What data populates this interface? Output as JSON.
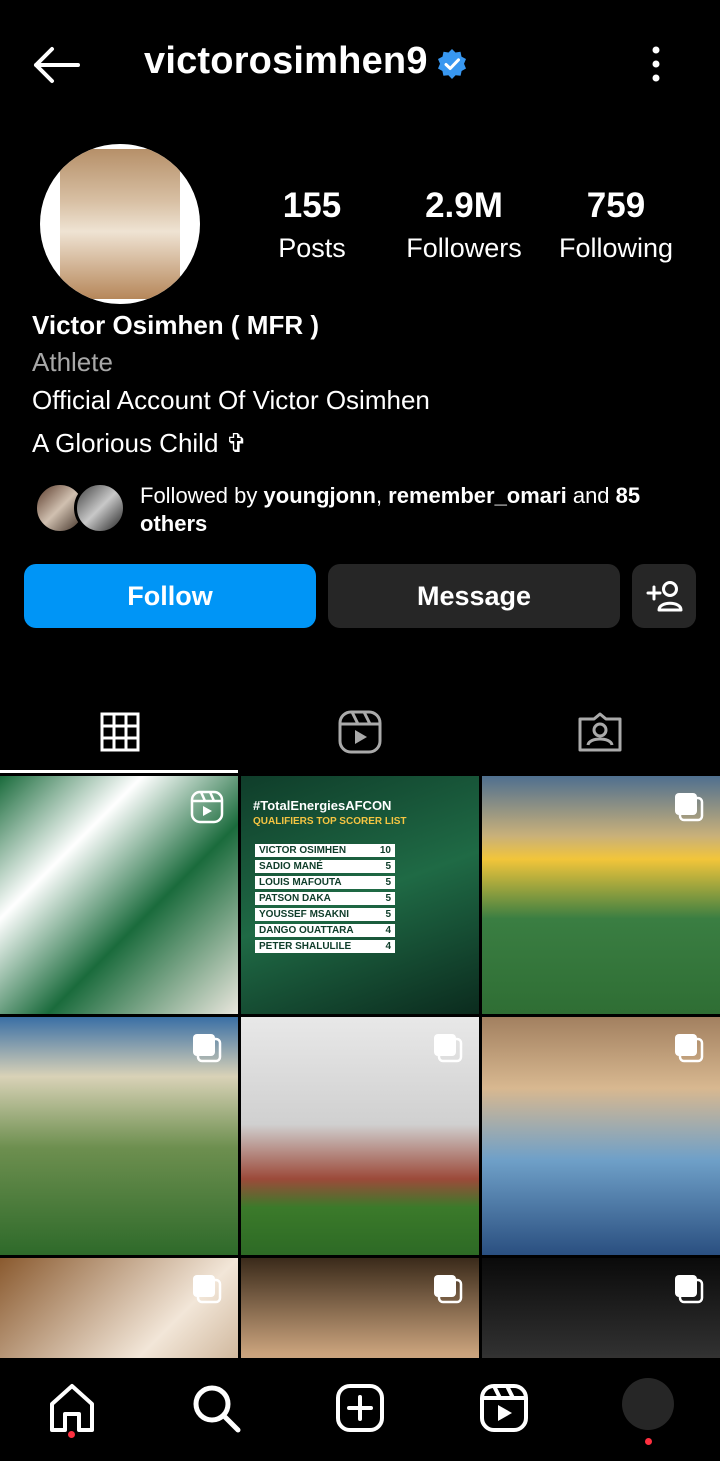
{
  "header": {
    "username": "victorosimhen9",
    "verified": true,
    "icons": [
      "back-arrow-icon",
      "verified-badge-icon",
      "more-options-icon"
    ]
  },
  "stats": {
    "posts": {
      "value": "155",
      "label": "Posts"
    },
    "followers": {
      "value": "2.9M",
      "label": "Followers"
    },
    "following": {
      "value": "759",
      "label": "Following"
    }
  },
  "profile": {
    "name": "Victor Osimhen ( MFR )",
    "category": "Athlete",
    "bio_line1": "Official Account Of Victor Osimhen",
    "bio_line2": "A Glorious Child ✞"
  },
  "followed_by": {
    "prefix": "Followed by ",
    "user1": "youngjonn",
    "separator": ", ",
    "user2": "remember_omari",
    "middle": " and ",
    "count": "85",
    "suffix": "others"
  },
  "actions": {
    "follow_label": "Follow",
    "message_label": "Message"
  },
  "tabs": [
    "grid-tab",
    "reels-tab",
    "tagged-tab"
  ],
  "grid": {
    "post2_caption": "#TotalEnergiesAFCON",
    "post2_subcaption": "QUALIFIERS TOP SCORER LIST",
    "post2_rows": [
      {
        "name": "VICTOR OSIMHEN",
        "goals": "10"
      },
      {
        "name": "SADIO MANÉ",
        "goals": "5"
      },
      {
        "name": "LOUIS MAFOUTA",
        "goals": "5"
      },
      {
        "name": "PATSON DAKA",
        "goals": "5"
      },
      {
        "name": "YOUSSEF MSAKNI",
        "goals": "5"
      },
      {
        "name": "DANGO OUATTARA",
        "goals": "4"
      },
      {
        "name": "PETER SHALULILE",
        "goals": "4"
      }
    ]
  },
  "colors": {
    "accent": "#0095f6",
    "button_secondary": "#262626",
    "notification_dot": "#ff3040",
    "secondary_text": "#a8a8a8"
  }
}
